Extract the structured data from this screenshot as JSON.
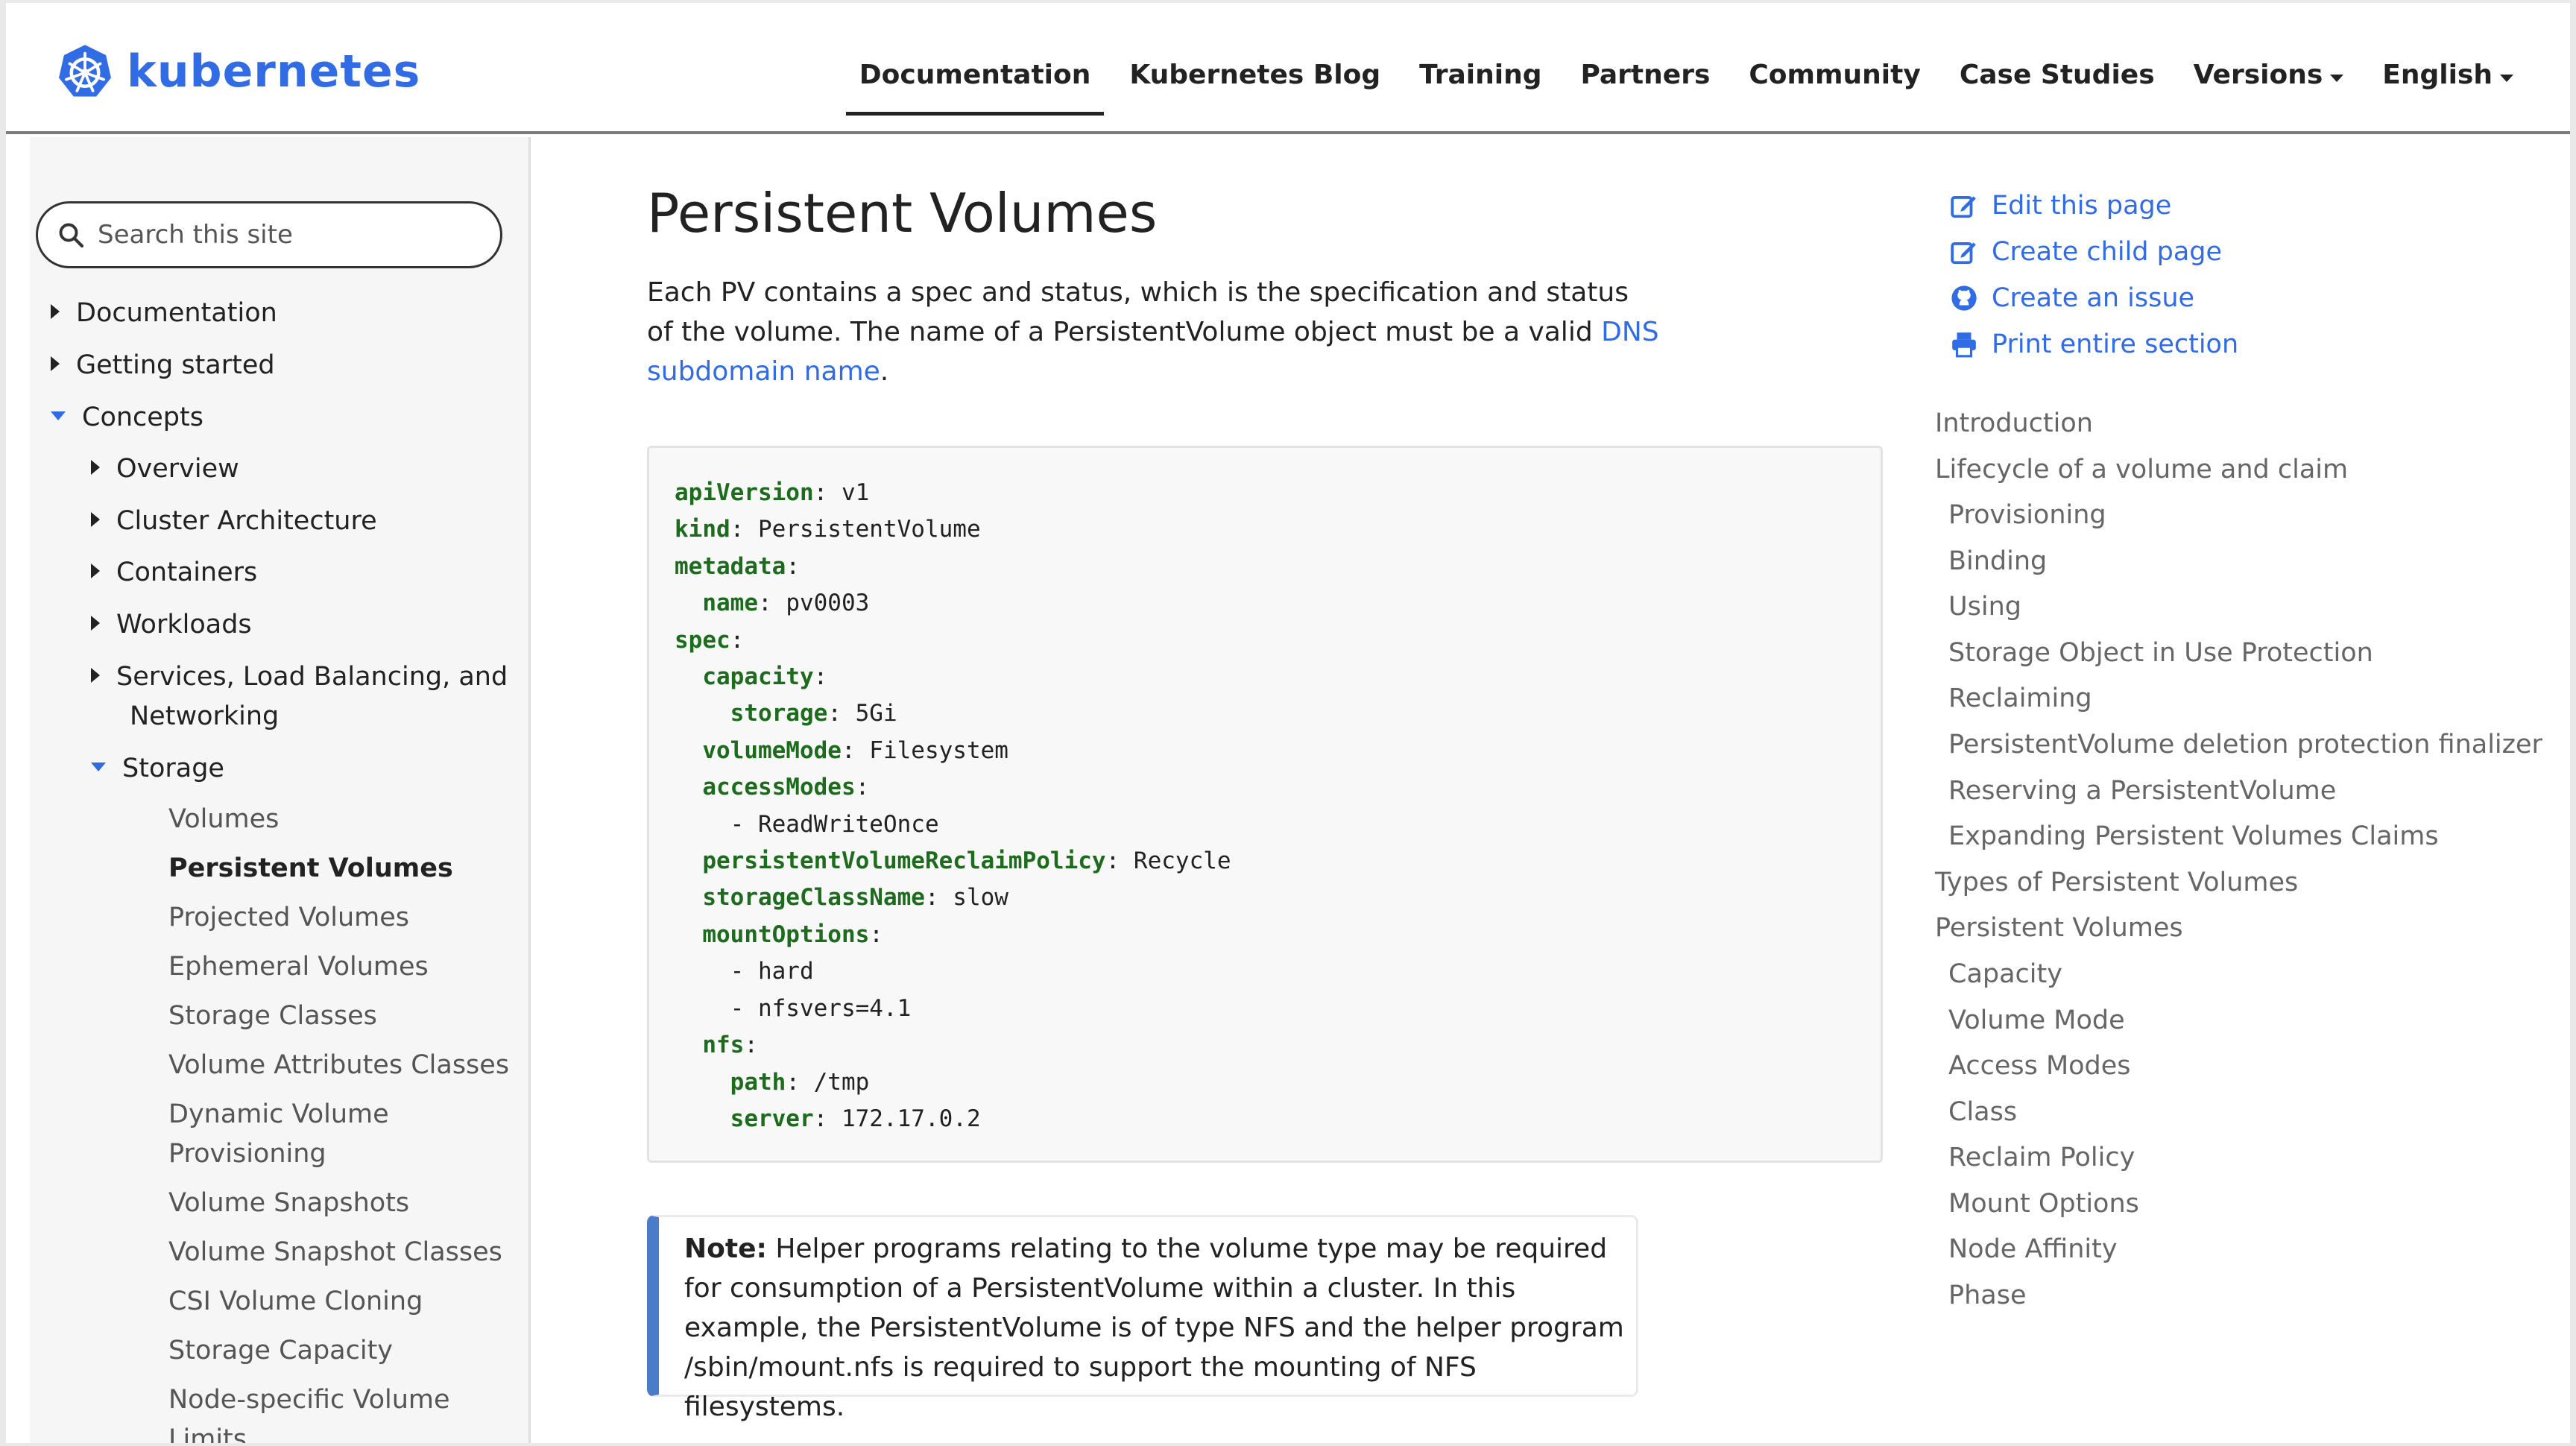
{
  "brand": {
    "name": "kubernetes",
    "color": "#326ce5"
  },
  "nav": {
    "links": [
      "Documentation",
      "Kubernetes Blog",
      "Training",
      "Partners",
      "Community",
      "Case Studies",
      "Versions",
      "English"
    ],
    "active": "Documentation"
  },
  "search": {
    "placeholder": "Search this site"
  },
  "sidebar": {
    "items": [
      {
        "label": "Documentation",
        "state": "collapsed"
      },
      {
        "label": "Getting started",
        "state": "collapsed"
      },
      {
        "label": "Concepts",
        "state": "expanded"
      },
      {
        "label": "Overview",
        "state": "collapsed"
      },
      {
        "label": "Cluster Architecture",
        "state": "collapsed"
      },
      {
        "label": "Containers",
        "state": "collapsed"
      },
      {
        "label": "Workloads",
        "state": "collapsed"
      },
      {
        "label": "Services, Load Balancing, and",
        "state": "collapsed"
      },
      {
        "label": "Networking",
        "state": "continuation"
      },
      {
        "label": "Storage",
        "state": "expanded"
      },
      {
        "label": "Volumes",
        "state": "leaf"
      },
      {
        "label": "Persistent Volumes",
        "state": "current"
      },
      {
        "label": "Projected Volumes",
        "state": "leaf"
      },
      {
        "label": "Ephemeral Volumes",
        "state": "leaf"
      },
      {
        "label": "Storage Classes",
        "state": "leaf"
      },
      {
        "label": "Volume Attributes Classes",
        "state": "leaf"
      },
      {
        "label": "Dynamic Volume",
        "state": "leaf"
      },
      {
        "label": "Provisioning",
        "state": "leaf"
      },
      {
        "label": "Volume Snapshots",
        "state": "leaf"
      },
      {
        "label": "Volume Snapshot Classes",
        "state": "leaf"
      },
      {
        "label": "CSI Volume Cloning",
        "state": "leaf"
      },
      {
        "label": "Storage Capacity",
        "state": "leaf"
      },
      {
        "label": "Node-specific Volume",
        "state": "leaf"
      },
      {
        "label": "Limits",
        "state": "leaf"
      }
    ]
  },
  "main": {
    "title": "Persistent Volumes",
    "intro_before": "Each PV contains a spec and status, which is the specification and status of the volume. The name of a PersistentVolume object must be a valid ",
    "intro_link": "DNS subdomain name",
    "intro_after": ".",
    "code": [
      {
        "key": "apiVersion",
        "value": " v1"
      },
      {
        "key": "kind",
        "value": " PersistentVolume"
      },
      {
        "key": "metadata",
        "value": ""
      },
      {
        "key": "  name",
        "value": " pv0003"
      },
      {
        "key": "spec",
        "value": ""
      },
      {
        "key": "  capacity",
        "value": ""
      },
      {
        "key": "    storage",
        "value": " 5Gi"
      },
      {
        "key": "  volumeMode",
        "value": " Filesystem"
      },
      {
        "key": "  accessModes",
        "value": ""
      },
      {
        "key": "",
        "value": "    - ReadWriteOnce"
      },
      {
        "key": "  persistentVolumeReclaimPolicy",
        "value": " Recycle"
      },
      {
        "key": "  storageClassName",
        "value": " slow"
      },
      {
        "key": "  mountOptions",
        "value": ""
      },
      {
        "key": "",
        "value": "    - hard"
      },
      {
        "key": "",
        "value": "    - nfsvers=4.1"
      },
      {
        "key": "  nfs",
        "value": ""
      },
      {
        "key": "    path",
        "value": " /tmp"
      },
      {
        "key": "    server",
        "value": " 172.17.0.2"
      }
    ],
    "note_label": "Note:",
    "note_text": " Helper programs relating to the volume type may be required for consumption of a PersistentVolume within a cluster. In this example, the PersistentVolume is of type NFS and the helper program /sbin/mount.nfs is required to support the mounting of NFS filesystems."
  },
  "toc": {
    "actions": [
      {
        "label": "Edit this page",
        "icon": "edit-icon"
      },
      {
        "label": "Create child page",
        "icon": "edit-icon"
      },
      {
        "label": "Create an issue",
        "icon": "github-icon"
      },
      {
        "label": "Print entire section",
        "icon": "print-icon"
      }
    ],
    "items": [
      {
        "label": "Introduction",
        "level": 1
      },
      {
        "label": "Lifecycle of a volume and claim",
        "level": 1
      },
      {
        "label": "Provisioning",
        "level": 2
      },
      {
        "label": "Binding",
        "level": 2
      },
      {
        "label": "Using",
        "level": 2
      },
      {
        "label": "Storage Object in Use Protection",
        "level": 2
      },
      {
        "label": "Reclaiming",
        "level": 2
      },
      {
        "label": "PersistentVolume deletion protection finalizer",
        "level": 2
      },
      {
        "label": "Reserving a PersistentVolume",
        "level": 2
      },
      {
        "label": "Expanding Persistent Volumes Claims",
        "level": 2
      },
      {
        "label": "Types of Persistent Volumes",
        "level": 1
      },
      {
        "label": "Persistent Volumes",
        "level": 1
      },
      {
        "label": "Capacity",
        "level": 2
      },
      {
        "label": "Volume Mode",
        "level": 2
      },
      {
        "label": "Access Modes",
        "level": 2
      },
      {
        "label": "Class",
        "level": 2
      },
      {
        "label": "Reclaim Policy",
        "level": 2
      },
      {
        "label": "Mount Options",
        "level": 2
      },
      {
        "label": "Node Affinity",
        "level": 2
      },
      {
        "label": "Phase",
        "level": 2
      }
    ]
  }
}
